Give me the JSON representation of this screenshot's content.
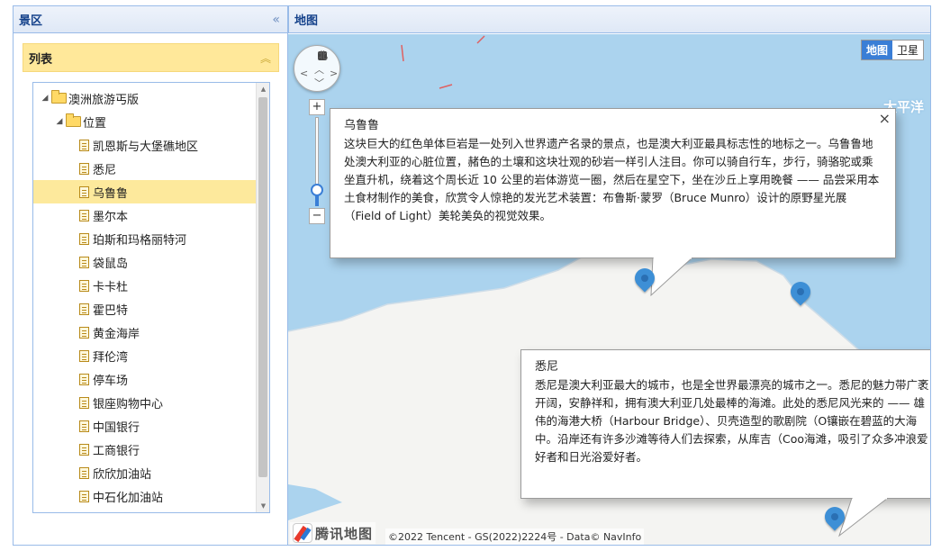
{
  "left_panel": {
    "title": "景区",
    "collapse_icon": "«",
    "list": {
      "title": "列表",
      "collapse_icon": "︽",
      "tree": {
        "root": {
          "label": "澳洲旅游丐版",
          "expanded_icon": "◢"
        },
        "group": {
          "label": "位置",
          "expanded_icon": "◢"
        },
        "items": [
          {
            "label": "凯恩斯与大堡礁地区"
          },
          {
            "label": "悉尼"
          },
          {
            "label": "乌鲁鲁",
            "selected": true
          },
          {
            "label": "墨尔本"
          },
          {
            "label": "珀斯和玛格丽特河"
          },
          {
            "label": "袋鼠岛"
          },
          {
            "label": "卡卡杜"
          },
          {
            "label": "霍巴特"
          },
          {
            "label": "黄金海岸"
          },
          {
            "label": "拜伦湾"
          },
          {
            "label": "停车场"
          },
          {
            "label": "银座购物中心"
          },
          {
            "label": "中国银行"
          },
          {
            "label": "工商银行"
          },
          {
            "label": "欣欣加油站"
          },
          {
            "label": "中石化加油站"
          }
        ]
      }
    }
  },
  "map_panel": {
    "title": "地图",
    "map_type": {
      "map_label": "地图",
      "satellite_label": "卫星",
      "active": "地图"
    },
    "ocean_label": "太平洋",
    "compass_label": "北",
    "zoom": {
      "plus": "+",
      "minus": "−",
      "level_fraction": 0.18
    },
    "popups": [
      {
        "title": "乌鲁鲁",
        "text": "这块巨大的红色单体巨岩是一处列入世界遗产名录的景点，也是澳大利亚最具标志性的地标之一。乌鲁鲁地处澳大利亚的心脏位置，赭色的土壤和这块壮观的砂岩一样引人注目。你可以骑自行车，步行，骑骆驼或乘坐直升机，绕着这个周长近 10 公里的岩体游览一圈，然后在星空下，坐在沙丘上享用晚餐 —— 品尝采用本土食材制作的美食，欣赏令人惊艳的发光艺术装置：布鲁斯·蒙罗（Bruce Munro）设计的原野星光展（Field of Light）美轮美奂的视觉效果。",
        "close": "×"
      },
      {
        "title": "悉尼",
        "text": "悉尼是澳大利亚最大的城市，也是全世界最漂亮的城市之一。悉尼的魅力带广袤开阔，安静祥和，拥有澳大利亚几处最棒的海滩。此处的悉尼风光来的 —— 雄伟的海港大桥（Harbour Bridge）、贝壳造型的歌剧院（O镶嵌在碧蓝的大海中。沿岸还有许多沙滩等待人们去探索，从库吉（Coo海滩，吸引了众多冲浪爱好者和日光浴爱好者。"
      }
    ],
    "attribution": {
      "logo_text": "腾讯地图",
      "copyright": "©2022 Tencent - GS(2022)2224号 - Data© NavInfo"
    }
  }
}
